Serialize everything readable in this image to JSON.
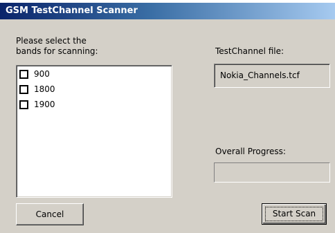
{
  "window": {
    "title": "GSM TestChannel Scanner"
  },
  "bands": {
    "prompt_line1": "Please select the",
    "prompt_line2": "bands for scanning:",
    "items": [
      {
        "label": "900",
        "checked": false
      },
      {
        "label": "1800",
        "checked": false
      },
      {
        "label": "1900",
        "checked": false
      }
    ]
  },
  "testchannel": {
    "label": "TestChannel file:",
    "value": "Nokia_Channels.tcf"
  },
  "progress": {
    "label": "Overall Progress:",
    "percent": 0
  },
  "buttons": {
    "cancel_label": "Cancel",
    "start_label": "Start Scan"
  },
  "colors": {
    "titlebar_start": "#0a246a",
    "titlebar_end": "#a6caf0",
    "dialog_face": "#d4d0c8"
  }
}
